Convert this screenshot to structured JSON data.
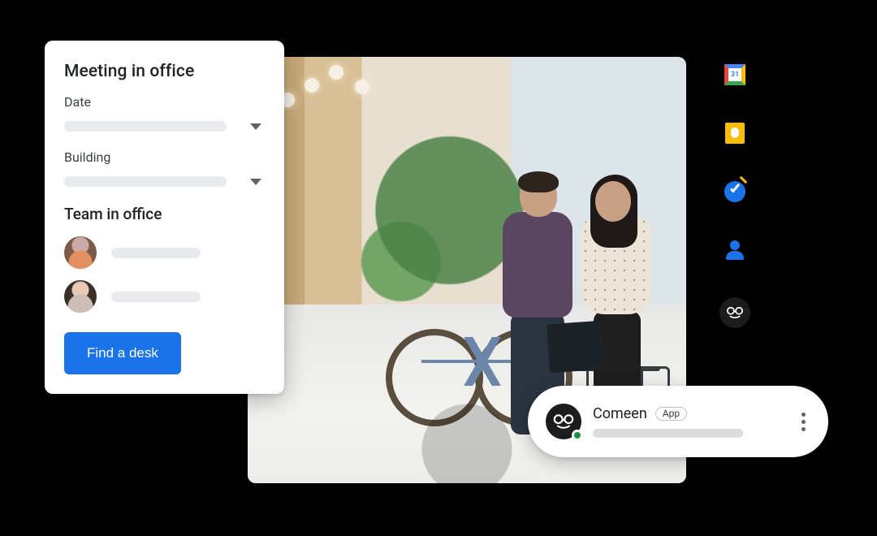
{
  "card": {
    "title": "Meeting in office",
    "date_label": "Date",
    "building_label": "Building",
    "team_heading": "Team in office",
    "cta": "Find a desk"
  },
  "chat": {
    "name": "Comeen",
    "badge": "App",
    "presence": "online"
  },
  "rail": {
    "calendar_day": "31",
    "items": [
      "calendar-icon",
      "keep-icon",
      "tasks-icon",
      "contacts-icon",
      "comeen-icon"
    ]
  }
}
